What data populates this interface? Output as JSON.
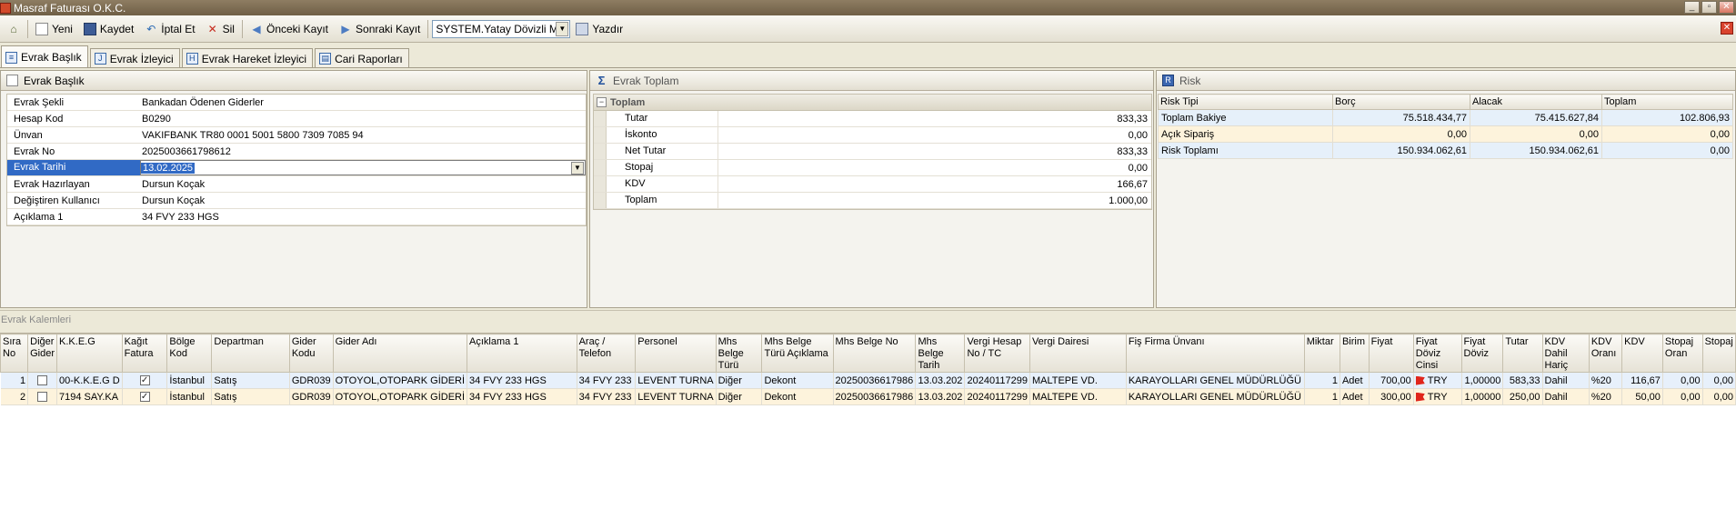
{
  "window": {
    "title": "Masraf Faturası O.K.C."
  },
  "toolbar": {
    "new_label": "Yeni",
    "save_label": "Kaydet",
    "cancel_label": "İptal Et",
    "delete_label": "Sil",
    "prev_label": "Önceki Kayıt",
    "next_label": "Sonraki Kayıt",
    "report_select": "SYSTEM.Yatay Dövizli M",
    "print_label": "Yazdır"
  },
  "tabs": [
    "Evrak Başlık",
    "Evrak İzleyici",
    "Evrak Hareket İzleyici",
    "Cari Raporları"
  ],
  "header_panel": {
    "title": "Evrak Başlık",
    "rows": [
      {
        "key": "Evrak Şekli",
        "value": "Bankadan Ödenen Giderler"
      },
      {
        "key": "Hesap Kod",
        "value": "B0290"
      },
      {
        "key": "Ünvan",
        "value": "VAKIFBANK TR80 0001 5001 5800 7309 7085 94"
      },
      {
        "key": "Evrak No",
        "value": "2025003661798612"
      },
      {
        "key": "Evrak Tarihi",
        "value": "13.02.2025"
      },
      {
        "key": "Evrak Hazırlayan",
        "value": "Dursun Koçak"
      },
      {
        "key": "Değiştiren Kullanıcı",
        "value": "Dursun Koçak"
      },
      {
        "key": "Açıklama 1",
        "value": "34 FVY 233 HGS"
      }
    ]
  },
  "total_panel": {
    "title": "Evrak Toplam",
    "group": "Toplam",
    "rows": [
      {
        "key": "Tutar",
        "value": "833,33"
      },
      {
        "key": "İskonto",
        "value": "0,00"
      },
      {
        "key": "Net Tutar",
        "value": "833,33"
      },
      {
        "key": "Stopaj",
        "value": "0,00"
      },
      {
        "key": "KDV",
        "value": "166,67"
      },
      {
        "key": "Toplam",
        "value": "1.000,00"
      }
    ]
  },
  "risk_panel": {
    "title": "Risk",
    "columns": [
      "Risk Tipi",
      "Borç",
      "Alacak",
      "Toplam"
    ],
    "rows": [
      [
        "Toplam Bakiye",
        "75.518.434,77",
        "75.415.627,84",
        "102.806,93"
      ],
      [
        "Açık Sipariş",
        "0,00",
        "0,00",
        "0,00"
      ],
      [
        "Risk Toplamı",
        "150.934.062,61",
        "150.934.062,61",
        "0,00"
      ]
    ]
  },
  "items": {
    "title": "Evrak Kalemleri",
    "columns": [
      "Sıra No",
      "Diğer Gider",
      "K.K.E.G",
      "Kağıt Fatura",
      "Bölge Kod",
      "Departman",
      "Gider Kodu",
      "Gider Adı",
      "Açıklama 1",
      "Araç / Telefon",
      "Personel",
      "Mhs Belge Türü",
      "Mhs Belge Türü Açıklama",
      "Mhs Belge No",
      "Mhs Belge Tarih",
      "Vergi Hesap No / TC",
      "Vergi Dairesi",
      "Fiş Firma Ünvanı",
      "Miktar",
      "Birim",
      "Fiyat",
      "Fiyat Döviz Cinsi",
      "Fiyat Döviz",
      "Tutar",
      "KDV Dahil Hariç",
      "KDV Oranı",
      "KDV",
      "Stopaj Oran",
      "Stopaj"
    ],
    "rows": [
      {
        "sira": "1",
        "kkeg": "00-K.K.E.G D",
        "bolge": "İstanbul",
        "departman": "Satış",
        "gider_kodu": "GDR039",
        "gider_adi": "OTOYOL,OTOPARK GİDERİ",
        "aciklama": "34 FVY 233 HGS",
        "arac": "34 FVY 233",
        "personel": "LEVENT TURNA",
        "belge_turu": "Diğer",
        "belge_turu_aciklama": "Dekont",
        "belge_no": "20250036617986",
        "belge_tarih": "13.03.202",
        "vergi_no": "20240117299",
        "vergi_dairesi": "MALTEPE VD.",
        "firma": "KARAYOLLARI GENEL MÜDÜRLÜĞÜ",
        "miktar": "1",
        "birim": "Adet",
        "fiyat": "700,00",
        "doviz_cinsi": "TRY",
        "doviz": "1,00000",
        "tutar": "583,33",
        "kdv_dahil": "Dahil",
        "kdv_oran": "%20",
        "kdv": "116,67",
        "stopaj_oran": "0,00",
        "stopaj": "0,00"
      },
      {
        "sira": "2",
        "kkeg": "7194 SAY.KA",
        "bolge": "İstanbul",
        "departman": "Satış",
        "gider_kodu": "GDR039",
        "gider_adi": "OTOYOL,OTOPARK GİDERİ",
        "aciklama": "34 FVY 233 HGS",
        "arac": "34 FVY 233",
        "personel": "LEVENT TURNA",
        "belge_turu": "Diğer",
        "belge_turu_aciklama": "Dekont",
        "belge_no": "20250036617986",
        "belge_tarih": "13.03.202",
        "vergi_no": "20240117299",
        "vergi_dairesi": "MALTEPE VD.",
        "firma": "KARAYOLLARI GENEL MÜDÜRLÜĞÜ",
        "miktar": "1",
        "birim": "Adet",
        "fiyat": "300,00",
        "doviz_cinsi": "TRY",
        "doviz": "1,00000",
        "tutar": "250,00",
        "kdv_dahil": "Dahil",
        "kdv_oran": "%20",
        "kdv": "50,00",
        "stopaj_oran": "0,00",
        "stopaj": "0,00"
      }
    ]
  }
}
